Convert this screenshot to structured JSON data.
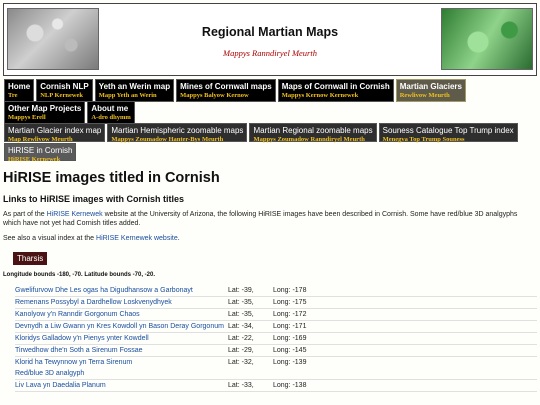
{
  "header": {
    "title": "Regional Martian Maps",
    "subtitle": "Mappys Ranndiryel Meurth"
  },
  "nav": {
    "row1": [
      {
        "en": "Home",
        "kw": "Tre",
        "active": false
      },
      {
        "en": "Cornish NLP",
        "kw": "NLP Kernewek",
        "active": false
      },
      {
        "en": "Yeth an Werin map",
        "kw": "Mapp Yeth an Werin",
        "active": false
      },
      {
        "en": "Mines of Cornwall maps",
        "kw": "Mappys Balyow Kernow",
        "active": false
      },
      {
        "en": "Maps of Cornwall in Cornish",
        "kw": "Mappys Kernow Kernewek",
        "active": false
      },
      {
        "en": "Martian Glaciers",
        "kw": "Rewlivow Meurth",
        "active": true
      }
    ],
    "row2": [
      {
        "en": "Other Map Projects",
        "kw": "Mappys Erell"
      },
      {
        "en": "About me",
        "kw": "A-dro dhymm"
      }
    ],
    "row3": [
      {
        "en": "Martian Glacier index map",
        "kw": "Map Rewlivow Meurth"
      },
      {
        "en": "Martian Hemispheric zoomable maps",
        "kw": "Mappys Zoumadow Hanter-Bys Meurth"
      },
      {
        "en": "Martian Regional zoomable maps",
        "kw": "Mappys Zoumadow Ranndiryel Meurth"
      },
      {
        "en": "Souness Catalogue Top Trump index",
        "kw": "Menegva Top Trump Souness"
      }
    ],
    "row4": [
      {
        "en": "HiRISE in Cornish",
        "kw": "HiRISE Kernewek"
      }
    ]
  },
  "main": {
    "title": "HiRISE images titled in Cornish",
    "subtitle": "Links to HiRISE images with Cornish titles",
    "intro_pre": "As part of the ",
    "intro_link": "HiRISE Kernewek",
    "intro_post": " website at the University of Arizona, the following HiRISE images have been described in Cornish. Some have red/blue 3D analgyphs which have not yet had Cornish titles added.",
    "see_pre": "See also a visual index at the ",
    "see_link": "HiRISE Kernewek website",
    "see_post": ".",
    "region_tag": "Tharsis",
    "bounds": "Longitude bounds -180, -70. Latitude bounds -70, -20.",
    "rows": [
      {
        "name": "Gwelifurvow Dhe Les ogas ha Digudhansow a Garbonayt",
        "lat": "Lat: -39,",
        "lon": "Long: -178"
      },
      {
        "name": "Remenans Possybyl a Dardhellow Loskvenydhyek",
        "lat": "Lat: -35,",
        "lon": "Long: -175"
      },
      {
        "name": "Kanolyow y'n Ranndir Gorgonum Chaos",
        "lat": "Lat: -35,",
        "lon": "Long: -172"
      },
      {
        "name": "Devnydh a Liw Gwann yn Kres Kowdoll yn Bason Deray Gorgonum",
        "lat": "Lat: -34,",
        "lon": "Long: -171"
      },
      {
        "name": "Kloridys Galladow y'n Pienys ynter Kowdell",
        "lat": "Lat: -22,",
        "lon": "Long: -169"
      },
      {
        "name": "Tirwedhow dhe'n Soth a Sirenum Fossae",
        "lat": "Lat: -29,",
        "lon": "Long: -145"
      },
      {
        "name": "Klorid ha Tewynnow yn Terra Sirenum",
        "lat": "Lat: -32,",
        "lon": "Long: -139"
      },
      {
        "name": "Red/blue 3D analgyph",
        "lat": "",
        "lon": ""
      },
      {
        "name": "Liv Lava yn Daedalia Planum",
        "lat": "Lat: -33,",
        "lon": "Long: -138"
      }
    ]
  }
}
